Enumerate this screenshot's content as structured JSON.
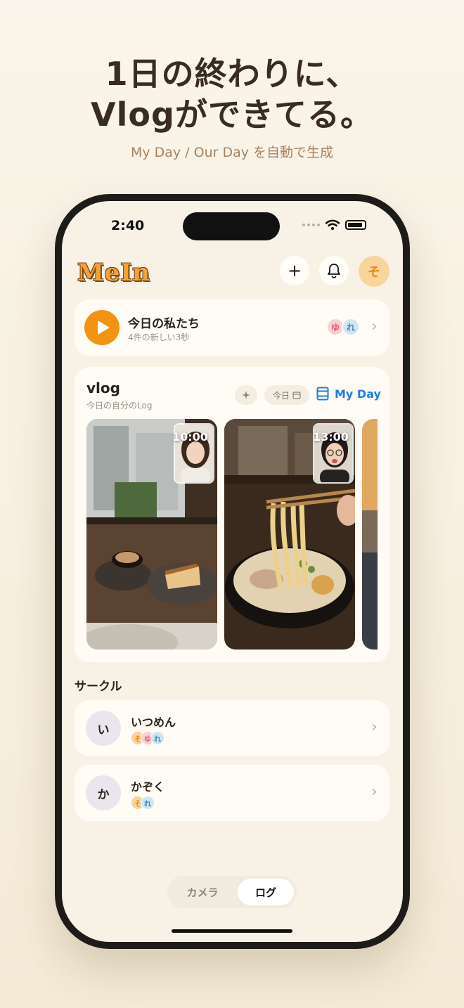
{
  "hero": {
    "title_line1": "1日の終わりに、",
    "title_line2": "Vlogができてる。",
    "subtitle": "My Day / Our Day を自動で生成"
  },
  "status_bar": {
    "time": "2:40"
  },
  "header": {
    "logo": "MeIn",
    "add_icon": "+",
    "profile_initial": "そ"
  },
  "today": {
    "title": "今日の私たち",
    "subtitle": "4件の新しい3秒",
    "members": [
      "ゆ",
      "れ"
    ]
  },
  "vlog": {
    "title": "vlog",
    "subtitle": "今日の自分のLog",
    "date_pill": "今日",
    "mode_label": "My Day",
    "clips": [
      {
        "time": "10:00",
        "scene": "coffee and cheesecake"
      },
      {
        "time": "13:00",
        "scene": "ramen"
      },
      {
        "time": "",
        "scene": "river at sunset"
      }
    ]
  },
  "circles": {
    "section_title": "サークル",
    "items": [
      {
        "initial": "い",
        "name": "いつめん",
        "members": [
          "そ",
          "ゆ",
          "れ"
        ]
      },
      {
        "initial": "か",
        "name": "かぞく",
        "members": [
          "そ",
          "れ"
        ]
      }
    ]
  },
  "tabs": {
    "camera": "カメラ",
    "log": "ログ"
  },
  "colors": {
    "accent_orange": "#f39313",
    "link_blue": "#1e7de0",
    "background": "#f8f2e6",
    "card": "#fffcf6"
  }
}
